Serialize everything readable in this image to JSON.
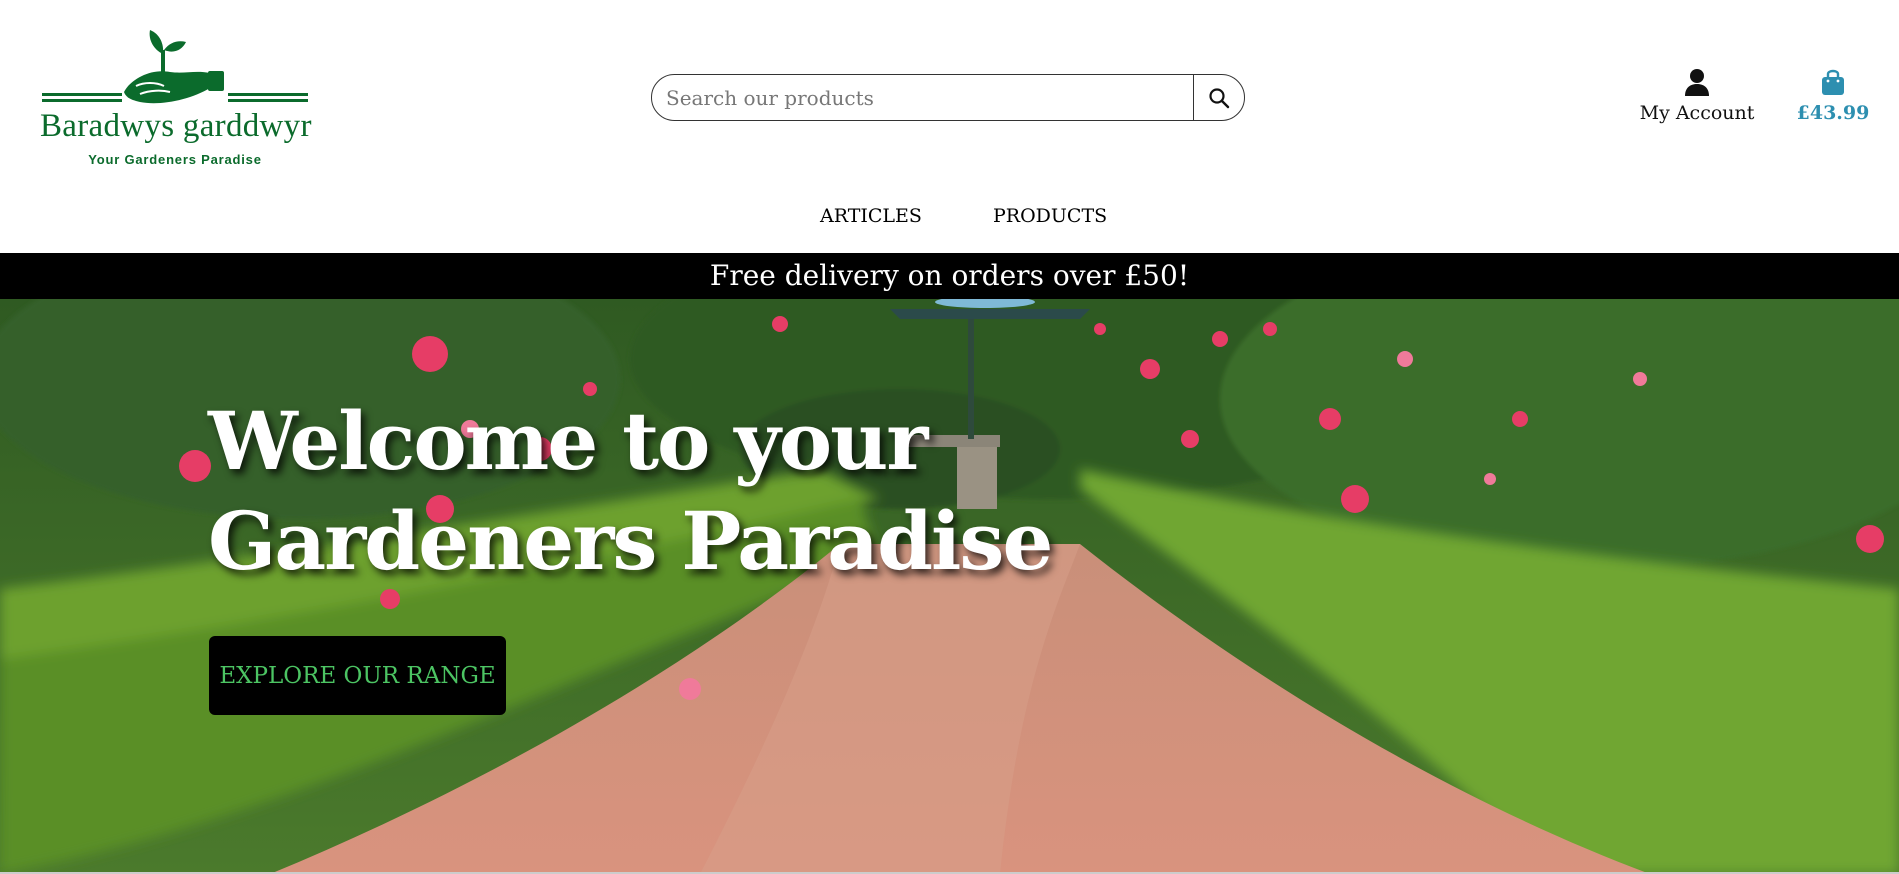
{
  "brand": {
    "name": "Baradwys garddwyr",
    "tagline": "Your Gardeners Paradise",
    "color": "#0b6b2c"
  },
  "search": {
    "placeholder": "Search our products",
    "value": "",
    "icon": "search-icon"
  },
  "account": {
    "label": "My Account",
    "icon": "user-icon"
  },
  "cart": {
    "total": "£43.99",
    "icon": "shopping-bag-icon",
    "color": "#2d8fb0"
  },
  "nav": {
    "items": [
      {
        "label": "ARTICLES"
      },
      {
        "label": "PRODUCTS"
      }
    ]
  },
  "banner": {
    "text": "Free delivery on orders over £50!"
  },
  "hero": {
    "title_line1": "Welcome to your",
    "title_line2": "Gardeners Paradise",
    "cta_label": "EXPLORE OUR RANGE",
    "cta_text_color": "#4cc463"
  }
}
